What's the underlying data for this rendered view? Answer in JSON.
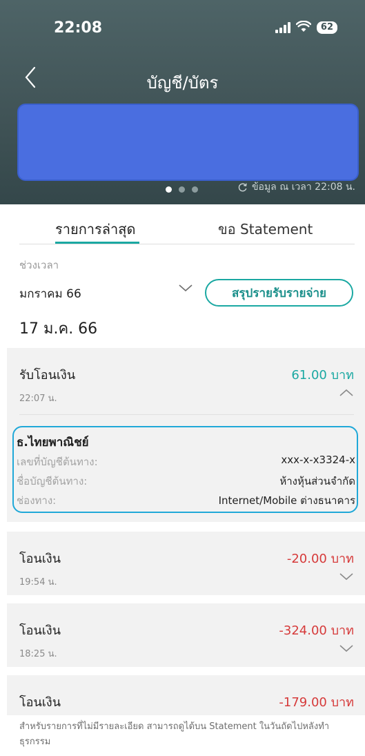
{
  "status_bar": {
    "time": "22:08",
    "battery": "62"
  },
  "header": {
    "title": "บัญชี/บัตร",
    "updated_text": "ข้อมูล ณ เวลา 22:08 น."
  },
  "tabs": {
    "recent": "รายการล่าสุด",
    "statement": "ขอ Statement"
  },
  "filter": {
    "period_label": "ช่วงเวลา",
    "month_value": "มกราคม 66",
    "summary_button": "สรุปรายรับรายจ่าย"
  },
  "date_heading": "17 ม.ค. 66",
  "transactions": [
    {
      "title": "รับโอนเงิน",
      "amount": "61.00 บาท",
      "time": "22:07 น.",
      "expanded": true,
      "detail": {
        "bank": "ธ.ไทยพาณิชย์",
        "rows": [
          {
            "label": "เลขที่บัญชีต้นทาง:",
            "value": "xxx-x-x3324-x"
          },
          {
            "label": "ชื่อบัญชีต้นทาง:",
            "value": "ห้างหุ้นส่วนจำกัด"
          },
          {
            "label": "ช่องทาง:",
            "value": "Internet/Mobile ต่างธนาคาร"
          }
        ]
      }
    },
    {
      "title": "โอนเงิน",
      "amount": "-20.00 บาท",
      "time": "19:54 น.",
      "expanded": false
    },
    {
      "title": "โอนเงิน",
      "amount": "-324.00 บาท",
      "time": "18:25 น.",
      "expanded": false
    },
    {
      "title": "โอนเงิน",
      "amount": "-179.00 บาท",
      "time": "",
      "expanded": false
    }
  ],
  "footer_note": "สำหรับรายการที่ไม่มีรายละเอียด สามารถดูได้บน Statement ในวันถัดไปหลังทำธุรกรรม",
  "colors": {
    "header": "#415457",
    "accent": "#1aa8a2",
    "negative": "#d63a3a",
    "card": "#4a6ee0",
    "detail_border": "#1fa8d8"
  }
}
